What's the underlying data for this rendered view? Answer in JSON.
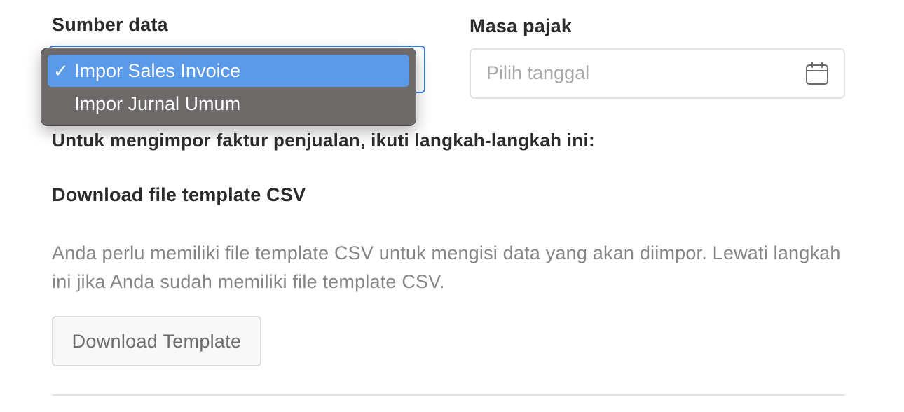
{
  "form": {
    "source_label": "Sumber data",
    "period_label": "Masa pajak",
    "source_options": [
      {
        "label": "Impor Sales Invoice",
        "selected": true
      },
      {
        "label": "Impor Jurnal Umum",
        "selected": false
      }
    ],
    "check_mark": "✓",
    "period_placeholder": "Pilih tanggal",
    "calendar_icon": "calendar-icon"
  },
  "instructions": {
    "heading": "Untuk mengimpor faktur penjualan, ikuti langkah-langkah ini:",
    "step_title": "Download file template CSV",
    "step_description": "Anda perlu memiliki file template CSV untuk mengisi data yang akan diimpor. Lewati langkah ini jika Anda sudah memiliki file template CSV.",
    "download_button": "Download Template"
  },
  "colors": {
    "select_focus_border": "#3b7be0",
    "dropdown_bg": "#6e6a69",
    "dropdown_highlight": "#5a9ae9",
    "placeholder_text": "#a9a9a9",
    "muted_text": "#858585"
  }
}
